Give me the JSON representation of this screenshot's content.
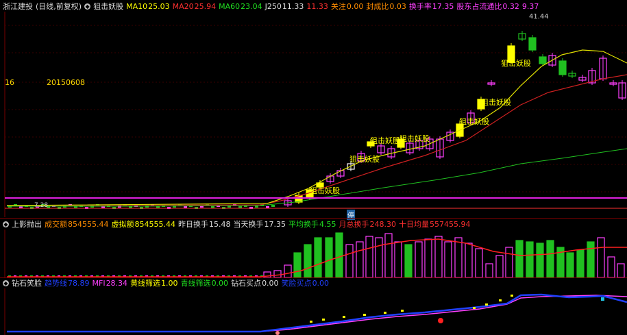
{
  "main": {
    "stock": "浙江建投",
    "period": "(日线,前复权)",
    "indicator": "狙击妖股",
    "ma10": {
      "label": "MA10",
      "value": "25.03",
      "color": "#ffff00"
    },
    "ma20": {
      "label": "MA20",
      "value": "25.94",
      "color": "#ff3030"
    },
    "ma60": {
      "label": "MA60",
      "value": "23.04",
      "color": "#20e020"
    },
    "j250": {
      "label": "J250",
      "value": "11.33"
    },
    "extra_val": "11.33",
    "attention": {
      "label": "关注",
      "value": "0.00"
    },
    "seal_ratio": {
      "label": "封成比",
      "value": "0.03"
    },
    "turnover": {
      "label": "换手率",
      "value": "17.35"
    },
    "float_ratio": {
      "label": "股东占流通比",
      "value": "0.32"
    },
    "float_extra": "9.37",
    "left_axis_val": "16",
    "date_label": "20150608",
    "high_label": "41.44",
    "low_label": "7.28",
    "marker_label": "停",
    "signal_labels": [
      "狙击妖股",
      "狙击妖股",
      "狙击妖股",
      "狙击妖股",
      "狙击妖股",
      "狙击妖股",
      "狙击妖股",
      "狙击妖股"
    ]
  },
  "sub1": {
    "name": "上影抛出",
    "volume": {
      "label": "成交额",
      "value": "854555.44"
    },
    "virtual": {
      "label": "虚拟额",
      "value": "854555.44"
    },
    "prev_turn": {
      "label": "昨日换手",
      "value": "15.48"
    },
    "today_turn": {
      "label": "当天换手",
      "value": "17.35"
    },
    "avg_turn": {
      "label": "平均换手",
      "value": "4.55"
    },
    "month_turn": {
      "label": "月总换手",
      "value": "248.30"
    },
    "ten_avg": {
      "label": "十日均量",
      "value": "557455.94"
    }
  },
  "sub2": {
    "name": "钻石笑脸",
    "trend": {
      "label": "趋势线",
      "value": "78.89"
    },
    "mfi": {
      "label": "MFI",
      "value": "28.34"
    },
    "yellow": {
      "label": "黄线筛选",
      "value": "1.00"
    },
    "cyan": {
      "label": "青线筛选",
      "value": "0.00"
    },
    "buy": {
      "label": "钻石买点",
      "value": "0.00"
    },
    "smile": {
      "label": "笑脸买点",
      "value": "0.00"
    }
  }
}
